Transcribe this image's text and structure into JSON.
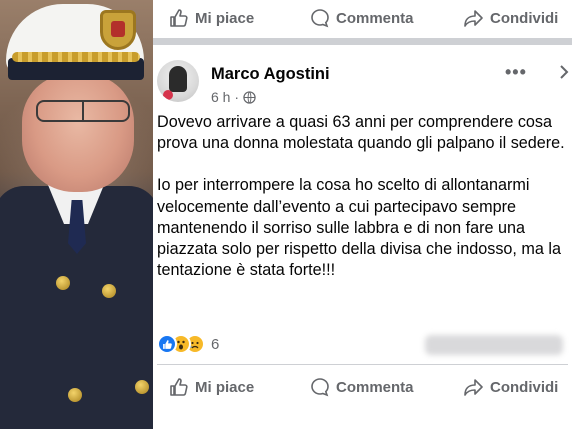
{
  "actions_top": {
    "like": "Mi piace",
    "comment": "Commenta",
    "share": "Condividi"
  },
  "post": {
    "author": "Marco Agostini",
    "time": "6 h ·",
    "privacy_icon": "globe-icon",
    "paragraphs": [
      "Dovevo arrivare a quasi 63 anni per comprendere cosa prova una donna molestata quando gli palpano il sedere.",
      "Io per interrompere la cosa ho scelto di allontanarmi velocemente dall’evento a cui partecipavo sempre mantenendo il sorriso sulle labbra e di non fare una piazzata solo per rispetto della divisa che indosso, ma la tentazione è stata forte!!!"
    ],
    "reactions": [
      "like",
      "wow",
      "sad"
    ],
    "reaction_count": "6"
  },
  "actions_bottom": {
    "like": "Mi piace",
    "comment": "Commenta",
    "share": "Condividi"
  },
  "colors": {
    "fb_gray": "#65676b",
    "fb_blue": "#1877f2",
    "divider": "#ced0d4"
  }
}
